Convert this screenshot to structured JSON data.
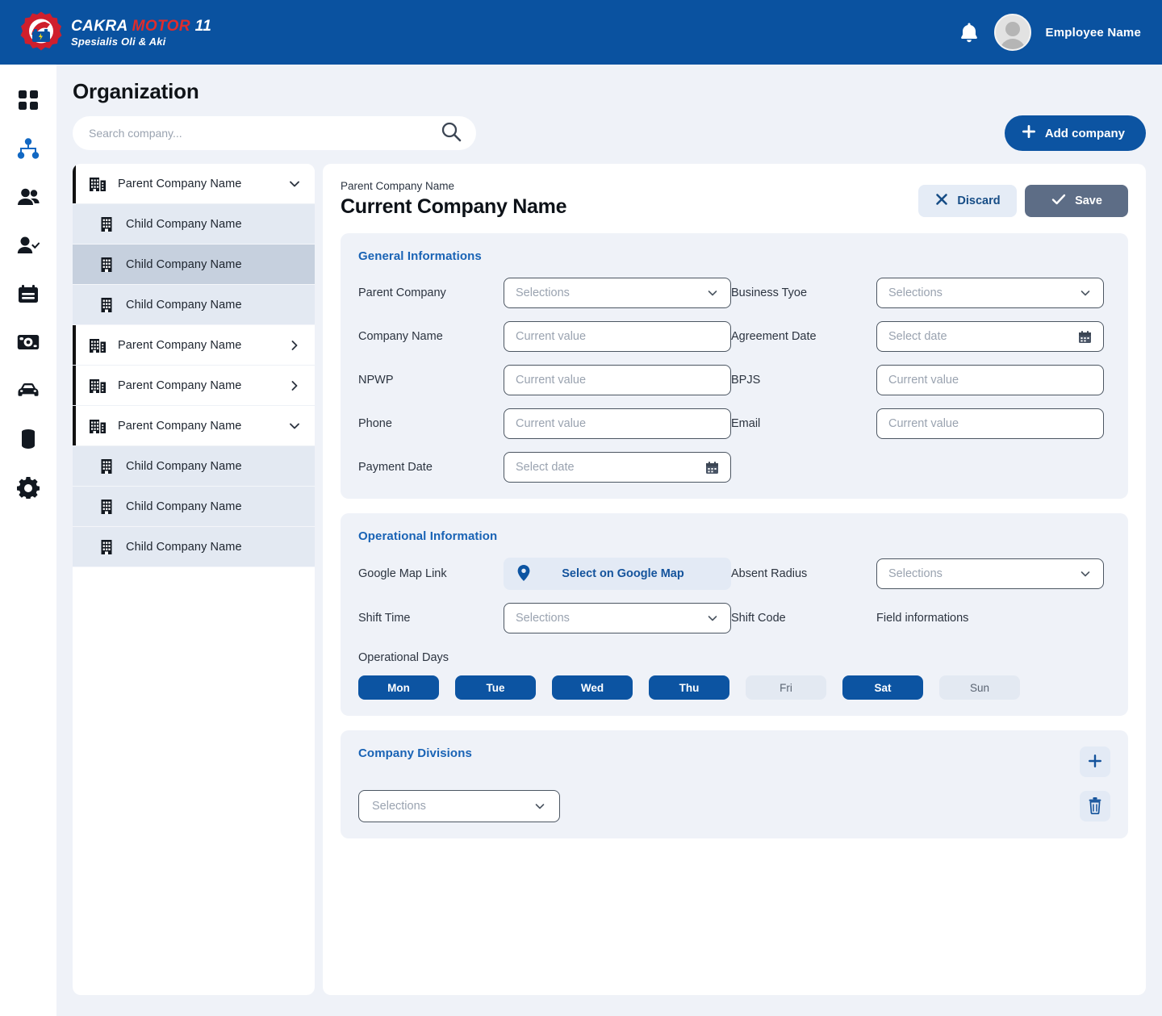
{
  "brand": {
    "line1_part1": "CAKRA",
    "line1_part2": "MOTOR",
    "line1_part3": "11",
    "line2": "Spesialis Oli & Aki",
    "colors": {
      "header_blue": "#0a52a0",
      "logo_red": "#e02c2c"
    }
  },
  "header": {
    "bell_icon": "bell-icon",
    "avatar_icon": "avatar-icon",
    "user_name": "Employee Name"
  },
  "sidebar": {
    "items": [
      {
        "icon": "dashboard-grid-icon",
        "name": "dashboard",
        "active": false
      },
      {
        "icon": "organization-hierarchy-icon",
        "name": "organization",
        "active": true
      },
      {
        "icon": "users-icon",
        "name": "employees",
        "active": false
      },
      {
        "icon": "user-check-icon",
        "name": "attendance",
        "active": false
      },
      {
        "icon": "card-icon",
        "name": "payroll",
        "active": false
      },
      {
        "icon": "camera-icon",
        "name": "inspection",
        "active": false
      },
      {
        "icon": "car-icon",
        "name": "vehicles",
        "active": false
      },
      {
        "icon": "battery-icon",
        "name": "inventory",
        "active": false
      },
      {
        "icon": "gear-icon",
        "name": "settings",
        "active": false
      }
    ],
    "accent_color": "#1268c3"
  },
  "page": {
    "title": "Organization"
  },
  "search": {
    "placeholder": "Search company...",
    "value": "",
    "icon": "search-icon"
  },
  "add_company": {
    "label": "Add company",
    "icon": "plus-icon"
  },
  "tree": {
    "items": [
      {
        "label": "Parent Company Name",
        "type": "parent",
        "caret": "chevron-down-icon",
        "selected": false
      },
      {
        "label": "Child Company Name",
        "type": "child",
        "caret": "",
        "selected": false
      },
      {
        "label": "Child Company Name",
        "type": "child",
        "caret": "",
        "selected": true
      },
      {
        "label": "Child Company Name",
        "type": "child",
        "caret": "",
        "selected": false
      },
      {
        "label": "Parent Company Name",
        "type": "parent",
        "caret": "chevron-right-icon",
        "selected": false
      },
      {
        "label": "Parent Company Name",
        "type": "parent",
        "caret": "chevron-right-icon",
        "selected": false
      },
      {
        "label": "Parent Company Name",
        "type": "parent",
        "caret": "chevron-down-icon",
        "selected": false
      },
      {
        "label": "Child Company Name",
        "type": "child",
        "caret": "",
        "selected": false
      },
      {
        "label": "Child Company Name",
        "type": "child",
        "caret": "",
        "selected": false
      },
      {
        "label": "Child Company Name",
        "type": "child",
        "caret": "",
        "selected": false
      }
    ]
  },
  "detail": {
    "breadcrumb": "Parent Company Name",
    "title": "Current Company Name",
    "discard_label": "Discard",
    "discard_icon": "close-x-icon",
    "save_label": "Save",
    "save_icon": "check-icon"
  },
  "general": {
    "title": "General Informations",
    "fields": [
      {
        "label": "Parent Company",
        "control": "select",
        "value": "Selections",
        "icon": "chevron-down-icon"
      },
      {
        "label": "Business Tyoe",
        "control": "select",
        "value": "Selections",
        "icon": "chevron-down-icon"
      },
      {
        "label": "Company Name",
        "control": "input",
        "value": "Current value",
        "icon": ""
      },
      {
        "label": "Agreement Date",
        "control": "date",
        "value": "Select date",
        "icon": "calendar-icon"
      },
      {
        "label": "NPWP",
        "control": "input",
        "value": "Current value",
        "icon": ""
      },
      {
        "label": "BPJS",
        "control": "input",
        "value": "Current value",
        "icon": ""
      },
      {
        "label": "Phone",
        "control": "input",
        "value": "Current value",
        "icon": ""
      },
      {
        "label": "Email",
        "control": "input",
        "value": "Current value",
        "icon": ""
      },
      {
        "label": "Payment Date",
        "control": "date",
        "value": "Select date",
        "icon": "calendar-icon"
      }
    ]
  },
  "operational": {
    "title": "Operational Information",
    "google_map_label": "Google Map Link",
    "google_map_button": "Select on Google Map",
    "google_map_icon": "map-pin-icon",
    "absent_radius_label": "Absent Radius",
    "absent_radius_value": "Selections",
    "shift_time_label": "Shift Time",
    "shift_time_value": "Selections",
    "shift_code_label": "Shift Code",
    "shift_code_value": "Field informations",
    "days_label": "Operational Days",
    "days": [
      {
        "label": "Mon",
        "active": true
      },
      {
        "label": "Tue",
        "active": true
      },
      {
        "label": "Wed",
        "active": true
      },
      {
        "label": "Thu",
        "active": true
      },
      {
        "label": "Fri",
        "active": false
      },
      {
        "label": "Sat",
        "active": true
      },
      {
        "label": "Sun",
        "active": false
      }
    ]
  },
  "divisions": {
    "title": "Company Divisions",
    "add_icon": "plus-icon",
    "delete_icon": "trash-icon",
    "rows": [
      {
        "value": "Selections",
        "icon": "chevron-down-icon"
      }
    ]
  }
}
